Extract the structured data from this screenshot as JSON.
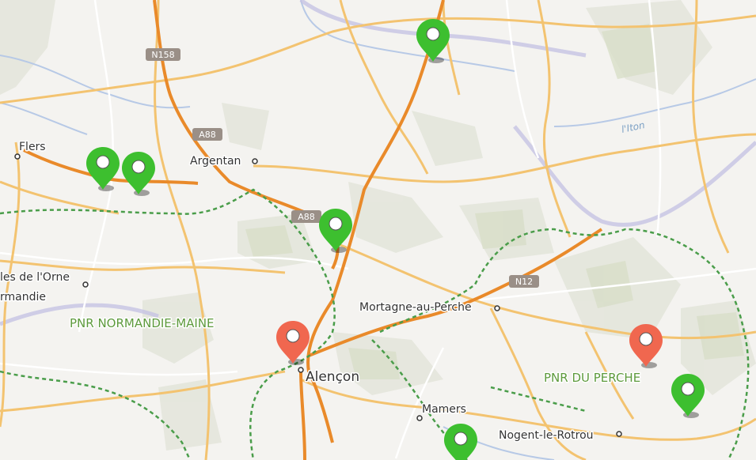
{
  "map": {
    "cities": [
      {
        "id": "flers",
        "name": "Flers"
      },
      {
        "id": "argentan",
        "name": "Argentan"
      },
      {
        "id": "orne",
        "name": "les de l'Orne"
      },
      {
        "id": "normandie",
        "name": "rmandie"
      },
      {
        "id": "mortagne",
        "name": "Mortagne-au-Perche"
      },
      {
        "id": "alencon",
        "name": "Alençon"
      },
      {
        "id": "mamers",
        "name": "Mamers"
      },
      {
        "id": "nogent",
        "name": "Nogent-le-Rotrou"
      }
    ],
    "parks": [
      {
        "id": "normandie-maine",
        "name": "PNR NORMANDIE-MAINE"
      },
      {
        "id": "perche",
        "name": "PNR DU PERCHE"
      }
    ],
    "rivers": [
      {
        "id": "iton",
        "name": "l'Iton"
      }
    ],
    "road_shields": [
      {
        "id": "n158",
        "label": "N158"
      },
      {
        "id": "a88-north",
        "label": "A88"
      },
      {
        "id": "a88-south",
        "label": "A88"
      },
      {
        "id": "n12",
        "label": "N12"
      }
    ],
    "markers": [
      {
        "id": "marker-1",
        "color": "#3dbf2f",
        "status": "green"
      },
      {
        "id": "marker-2",
        "color": "#3dbf2f",
        "status": "green"
      },
      {
        "id": "marker-3",
        "color": "#3dbf2f",
        "status": "green"
      },
      {
        "id": "marker-4",
        "color": "#3dbf2f",
        "status": "green"
      },
      {
        "id": "marker-5",
        "color": "#f0674f",
        "status": "red"
      },
      {
        "id": "marker-6",
        "color": "#f0674f",
        "status": "red"
      },
      {
        "id": "marker-7",
        "color": "#3dbf2f",
        "status": "green"
      },
      {
        "id": "marker-8",
        "color": "#3dbf2f",
        "status": "green"
      }
    ]
  }
}
